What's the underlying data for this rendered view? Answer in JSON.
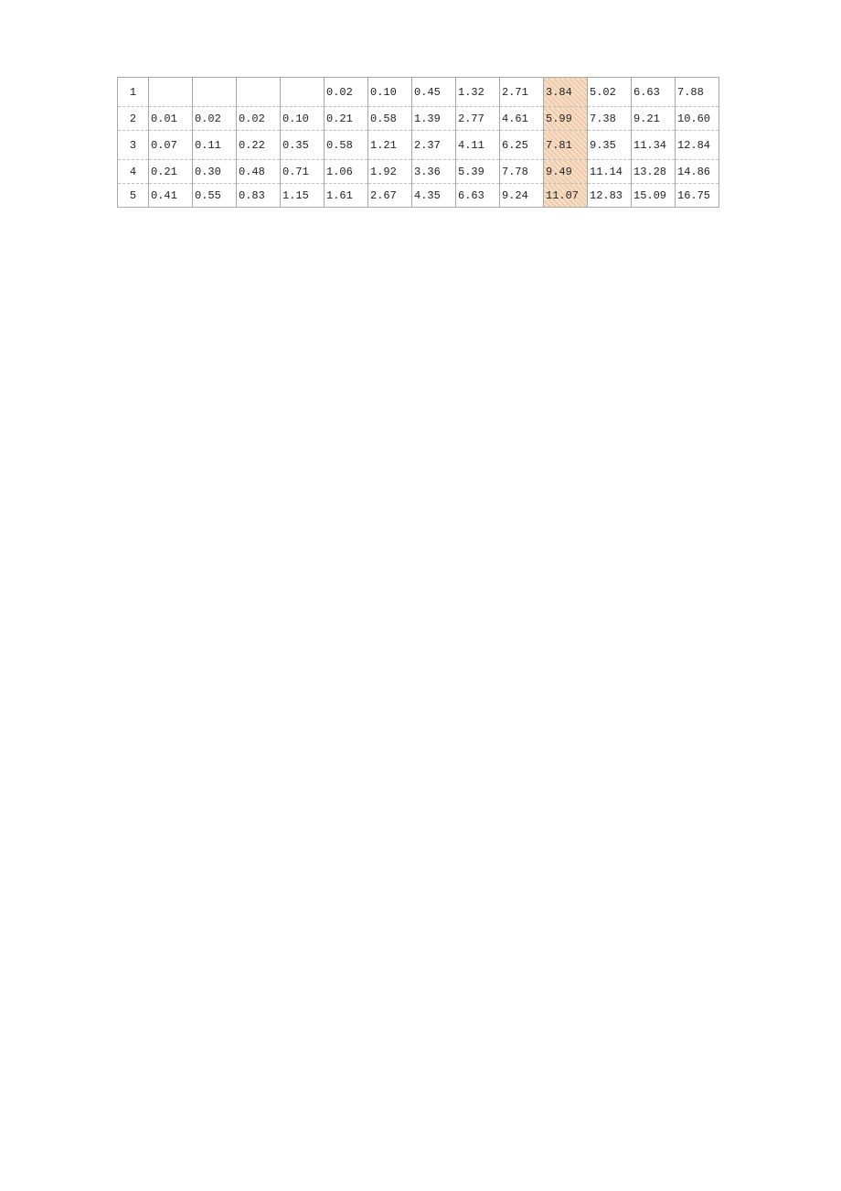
{
  "chart_data": {
    "type": "table",
    "title": "",
    "highlight_column_index": 9,
    "row_labels": [
      "1",
      "2",
      "3",
      "4",
      "5"
    ],
    "rows": [
      [
        "",
        "",
        "",
        "",
        "0.02",
        "0.10",
        "0.45",
        "1.32",
        "2.71",
        "3.84",
        "5.02",
        "6.63",
        "7.88"
      ],
      [
        "0.01",
        "0.02",
        "0.02",
        "0.10",
        "0.21",
        "0.58",
        "1.39",
        "2.77",
        "4.61",
        "5.99",
        "7.38",
        "9.21",
        "10.60"
      ],
      [
        "0.07",
        "0.11",
        "0.22",
        "0.35",
        "0.58",
        "1.21",
        "2.37",
        "4.11",
        "6.25",
        "7.81",
        "9.35",
        "11.34",
        "12.84"
      ],
      [
        "0.21",
        "0.30",
        "0.48",
        "0.71",
        "1.06",
        "1.92",
        "3.36",
        "5.39",
        "7.78",
        "9.49",
        "11.14",
        "13.28",
        "14.86"
      ],
      [
        "0.41",
        "0.55",
        "0.83",
        "1.15",
        "1.61",
        "2.67",
        "4.35",
        "6.63",
        "9.24",
        "11.07",
        "12.83",
        "15.09",
        "16.75"
      ]
    ]
  }
}
